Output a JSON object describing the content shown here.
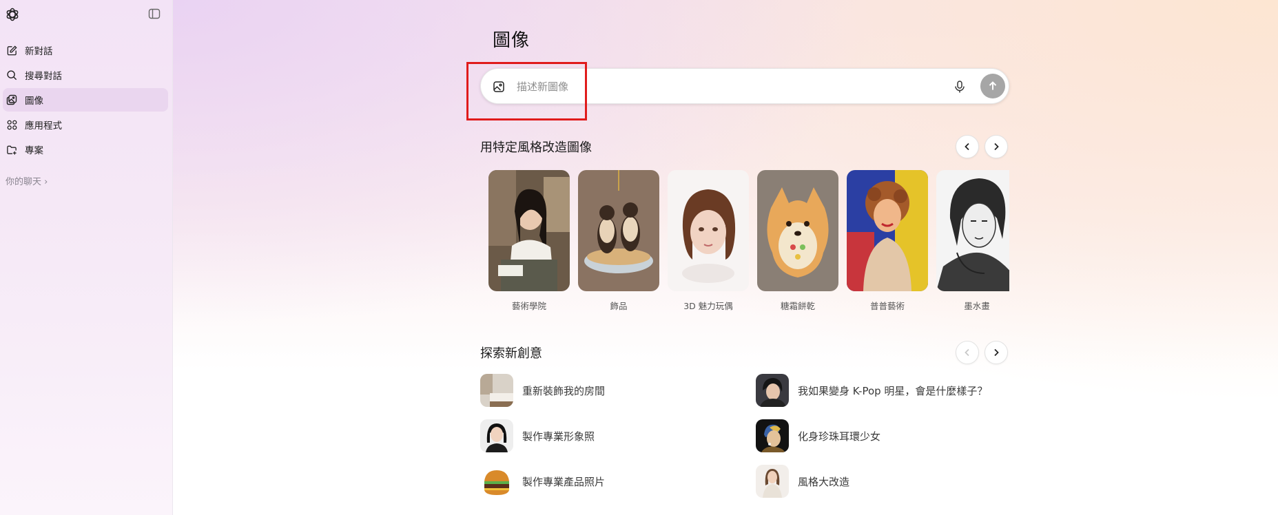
{
  "sidebar": {
    "items": [
      {
        "label": "新對話",
        "icon": "edit-icon"
      },
      {
        "label": "搜尋對話",
        "icon": "search-icon"
      },
      {
        "label": "圖像",
        "icon": "images-icon"
      },
      {
        "label": "應用程式",
        "icon": "apps-grid-icon"
      },
      {
        "label": "專案",
        "icon": "folder-plus-icon"
      }
    ],
    "chats_label": "你的聊天 ›"
  },
  "main": {
    "title": "圖像",
    "prompt": {
      "placeholder": "描述新圖像"
    },
    "styles_section": {
      "title": "用特定風格改造圖像",
      "items": [
        {
          "label": "藝術學院"
        },
        {
          "label": "飾品"
        },
        {
          "label": "3D 魅力玩偶"
        },
        {
          "label": "糖霜餅乾"
        },
        {
          "label": "普普藝術"
        },
        {
          "label": "墨水畫"
        }
      ]
    },
    "ideas_section": {
      "title": "探索新創意",
      "items": [
        {
          "text": "重新裝飾我的房間"
        },
        {
          "text": "我如果變身 K-Pop 明星，會是什麼樣子？"
        },
        {
          "text": "製作專業形象照"
        },
        {
          "text": "化身珍珠耳環少女"
        },
        {
          "text": "製作專業產品照片"
        },
        {
          "text": "風格大改造"
        }
      ]
    }
  },
  "colors": {
    "highlight_box": "#e01b1b",
    "send_button": "#a6a6a6",
    "active_nav": "#ead6ef"
  }
}
